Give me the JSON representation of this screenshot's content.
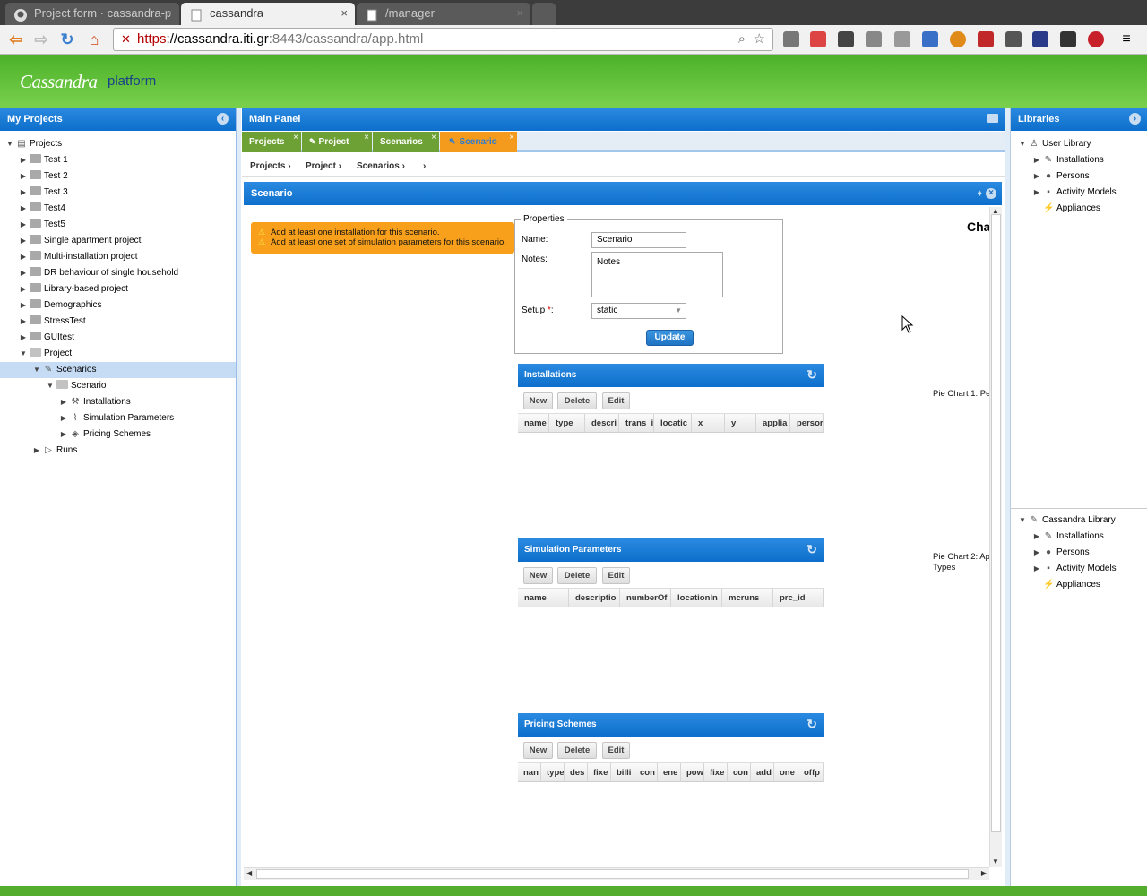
{
  "browser": {
    "tabs": [
      {
        "title": "Project form · cassandra-p",
        "close": "×"
      },
      {
        "title": "cassandra",
        "close": "×"
      },
      {
        "title": "/manager",
        "close": "×"
      }
    ],
    "url": {
      "scheme": "https",
      "host": "://cassandra.iti.gr",
      "rest": ":8443/cassandra/app.html"
    }
  },
  "app": {
    "logo": "Cassandra",
    "subtitle": "platform"
  },
  "left_panel": {
    "title": "My Projects",
    "tree": [
      {
        "label": "Projects"
      },
      {
        "label": "Test 1"
      },
      {
        "label": "Test 2"
      },
      {
        "label": "Test 3"
      },
      {
        "label": "Test4"
      },
      {
        "label": "Test5"
      },
      {
        "label": "Single apartment project"
      },
      {
        "label": "Multi-installation project"
      },
      {
        "label": "DR behaviour of single household"
      },
      {
        "label": "Library-based project"
      },
      {
        "label": "Demographics"
      },
      {
        "label": "StressTest"
      },
      {
        "label": "GUItest"
      },
      {
        "label": "Project"
      },
      {
        "label": "Scenarios"
      },
      {
        "label": "Scenario"
      },
      {
        "label": "Installations"
      },
      {
        "label": "Simulation Parameters"
      },
      {
        "label": "Pricing Schemes"
      },
      {
        "label": "Runs"
      }
    ]
  },
  "main": {
    "title": "Main Panel",
    "tabs": [
      {
        "label": "Projects"
      },
      {
        "label": "Project"
      },
      {
        "label": "Scenarios"
      },
      {
        "label": "Scenario"
      }
    ],
    "breadcrumb": [
      "Projects ›",
      "Project ›",
      "Scenarios ›",
      "›"
    ],
    "scenario_title": "Scenario",
    "warnings": [
      "Add at least one installation for this scenario.",
      "Add at least one set of simulation parameters for this scenario."
    ],
    "properties": {
      "legend": "Properties",
      "name_label": "Name:",
      "name_value": "Scenario",
      "notes_label": "Notes:",
      "notes_value": "Notes",
      "setup_label": "Setup",
      "setup_req": "*",
      "setup_colon": ":",
      "setup_value": "static",
      "update": "Update"
    },
    "installations": {
      "title": "Installations",
      "buttons": [
        "New",
        "Delete",
        "Edit"
      ],
      "columns": [
        "name",
        "type",
        "descri",
        "trans_i",
        "locatic",
        "x",
        "y",
        "applia",
        "persor"
      ]
    },
    "simulation_parameters": {
      "title": "Simulation Parameters",
      "buttons": [
        "New",
        "Delete",
        "Edit"
      ],
      "columns": [
        "name",
        "descriptio",
        "numberOf",
        "locationIn",
        "mcruns",
        "prc_id"
      ]
    },
    "pricing_schemes": {
      "title": "Pricing Schemes",
      "buttons": [
        "New",
        "Delete",
        "Edit"
      ],
      "columns": [
        "nan",
        "type",
        "des",
        "fixe",
        "billi",
        "con",
        "ene",
        "pow",
        "fixe",
        "con",
        "add",
        "one",
        "offp"
      ]
    },
    "charts": {
      "heading": "Cha",
      "pie1": "Pie Chart 1: Pe",
      "pie2_line1": "Pie Chart 2: Ap",
      "pie2_line2": "Types"
    }
  },
  "right_panel": {
    "title": "Libraries",
    "user_library": [
      "User Library",
      "Installations",
      "Persons",
      "Activity Models",
      "Appliances"
    ],
    "cassandra_library": [
      "Cassandra Library",
      "Installations",
      "Persons",
      "Activity Models",
      "Appliances"
    ]
  }
}
